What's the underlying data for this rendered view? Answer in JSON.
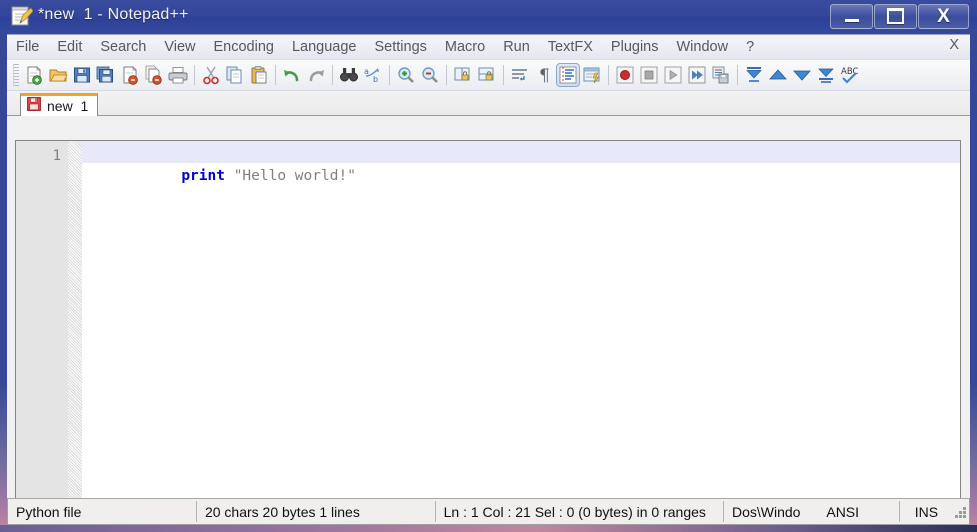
{
  "window": {
    "title": "*new  1 - Notepad++",
    "app_icon": "notepad-pencil-icon",
    "caption": {
      "minimize_label": "Minimize",
      "maximize_label": "Maximize",
      "close_label": "X"
    },
    "titlebar_color": "#32459a"
  },
  "menu": {
    "items": [
      {
        "label": "File"
      },
      {
        "label": "Edit"
      },
      {
        "label": "Search"
      },
      {
        "label": "View"
      },
      {
        "label": "Encoding"
      },
      {
        "label": "Language"
      },
      {
        "label": "Settings"
      },
      {
        "label": "Macro"
      },
      {
        "label": "Run"
      },
      {
        "label": "TextFX"
      },
      {
        "label": "Plugins"
      },
      {
        "label": "Window"
      },
      {
        "label": "?"
      }
    ],
    "close_document_label": "X"
  },
  "toolbar": {
    "buttons": [
      {
        "name": "new-file-icon",
        "tip": "New"
      },
      {
        "name": "open-file-icon",
        "tip": "Open"
      },
      {
        "name": "save-icon",
        "tip": "Save"
      },
      {
        "name": "save-all-icon",
        "tip": "Save All"
      },
      {
        "name": "close-file-icon",
        "tip": "Close"
      },
      {
        "name": "close-all-icon",
        "tip": "Close All"
      },
      {
        "name": "print-icon",
        "tip": "Print"
      },
      {
        "name": "cut-icon",
        "tip": "Cut"
      },
      {
        "name": "copy-icon",
        "tip": "Copy"
      },
      {
        "name": "paste-icon",
        "tip": "Paste"
      },
      {
        "name": "undo-icon",
        "tip": "Undo"
      },
      {
        "name": "redo-icon",
        "tip": "Redo"
      },
      {
        "name": "find-icon",
        "tip": "Find"
      },
      {
        "name": "replace-icon",
        "tip": "Replace"
      },
      {
        "name": "zoom-in-icon",
        "tip": "Zoom In"
      },
      {
        "name": "zoom-out-icon",
        "tip": "Zoom Out"
      },
      {
        "name": "sync-vertical-scroll-icon",
        "tip": "Synchronize Vertical Scrolling"
      },
      {
        "name": "sync-horizontal-scroll-icon",
        "tip": "Synchronize Horizontal Scrolling"
      },
      {
        "name": "word-wrap-icon",
        "tip": "Word wrap"
      },
      {
        "name": "show-all-characters-icon",
        "tip": "Show All Characters"
      },
      {
        "name": "indent-guide-icon",
        "tip": "Show Indent Guide",
        "pressed": true
      },
      {
        "name": "user-defined-language-icon",
        "tip": "User-Defined Dialogue"
      },
      {
        "name": "record-macro-icon",
        "tip": "Start Recording"
      },
      {
        "name": "stop-macro-icon",
        "tip": "Stop Recording"
      },
      {
        "name": "play-macro-icon",
        "tip": "Playback"
      },
      {
        "name": "run-macro-multiple-icon",
        "tip": "Run a Macro Multiple Times"
      },
      {
        "name": "save-macro-icon",
        "tip": "Save Currently Recorded Macro"
      },
      {
        "name": "collapse-all-icon",
        "tip": "Collapse All"
      },
      {
        "name": "fold-up-icon",
        "tip": "Fold"
      },
      {
        "name": "fold-down-icon",
        "tip": "Unfold"
      },
      {
        "name": "expand-all-icon",
        "tip": "Expand All"
      },
      {
        "name": "spell-check-icon",
        "tip": "Spell Check"
      }
    ]
  },
  "tabs": {
    "active_index": 0,
    "items": [
      {
        "label": "new  1",
        "icon": "unsaved-floppy-icon",
        "modified": true
      }
    ],
    "active_accent_color": "#f5a22d"
  },
  "editor": {
    "line_numbers": [
      "1"
    ],
    "current_line": 1,
    "current_line_highlight": "#e8e8fb",
    "lines": [
      {
        "tokens": [
          {
            "text": "print",
            "type": "keyword"
          },
          {
            "text": " ",
            "type": "plain"
          },
          {
            "text": "\"Hello world!\"",
            "type": "string"
          }
        ]
      }
    ],
    "keyword_color": "#0000d0",
    "string_color": "#808080"
  },
  "status_bar": {
    "doc_type": "Python file",
    "counts": "20 chars  20 bytes  1 lines",
    "caret": "Ln : 1    Col : 21    Sel : 0 (0 bytes) in 0 ranges",
    "eol": "Dos\\Windo",
    "encoding": "ANSI",
    "insert_mode": "INS"
  }
}
